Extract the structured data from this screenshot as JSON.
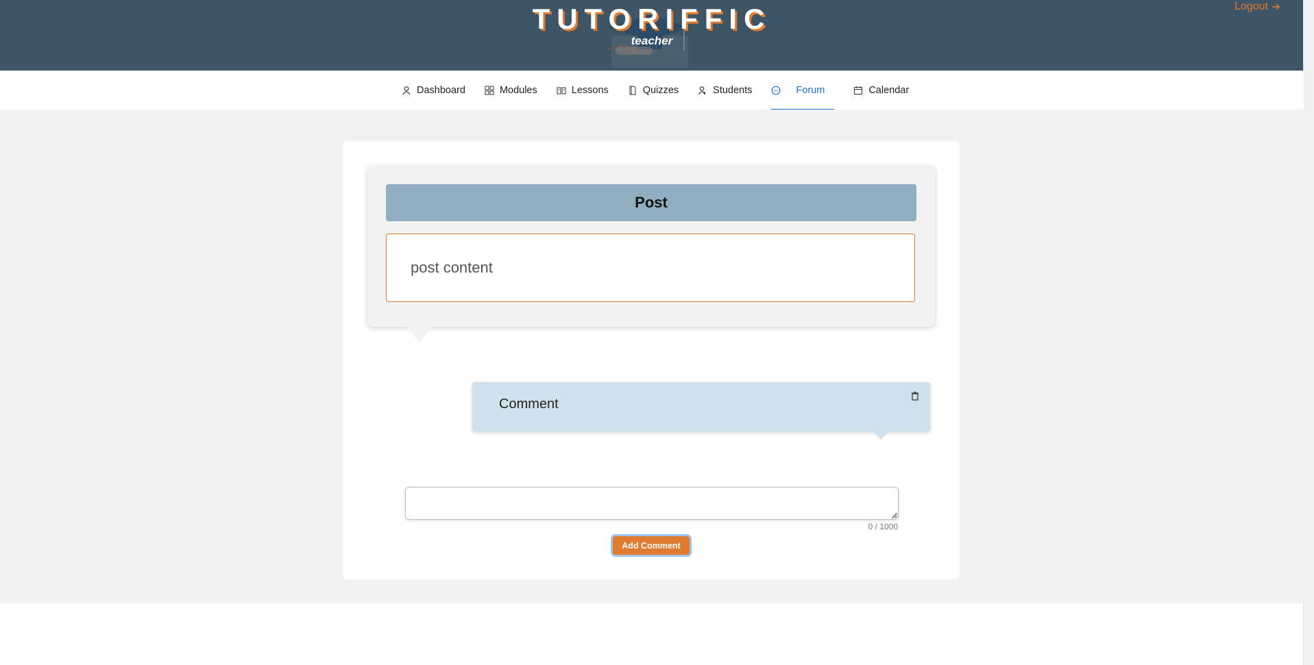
{
  "header": {
    "brand": "TUTORIFFIC",
    "role": "teacher",
    "logout_label": "Logout"
  },
  "nav": {
    "items": [
      {
        "label": "Dashboard",
        "icon": "user-icon",
        "active": false
      },
      {
        "label": "Modules",
        "icon": "grid-icon",
        "active": false
      },
      {
        "label": "Lessons",
        "icon": "book-open-icon",
        "active": false
      },
      {
        "label": "Quizzes",
        "icon": "document-icon",
        "active": false
      },
      {
        "label": "Students",
        "icon": "students-icon",
        "active": false
      },
      {
        "label": "Forum",
        "icon": "chat-bubble-icon",
        "active": true
      },
      {
        "label": "Calendar",
        "icon": "calendar-icon",
        "active": false
      }
    ]
  },
  "post": {
    "title": "Post",
    "content": "post content"
  },
  "comments": [
    {
      "text": "Comment"
    }
  ],
  "comment_form": {
    "value": "",
    "counter": "0 / 1000",
    "submit_label": "Add Comment"
  },
  "colors": {
    "header_bg": "#3d5566",
    "accent": "#e07a2e",
    "active_nav": "#1f6fd1",
    "post_title_bg": "#91aec1",
    "comment_bg": "#cfe1ec"
  }
}
